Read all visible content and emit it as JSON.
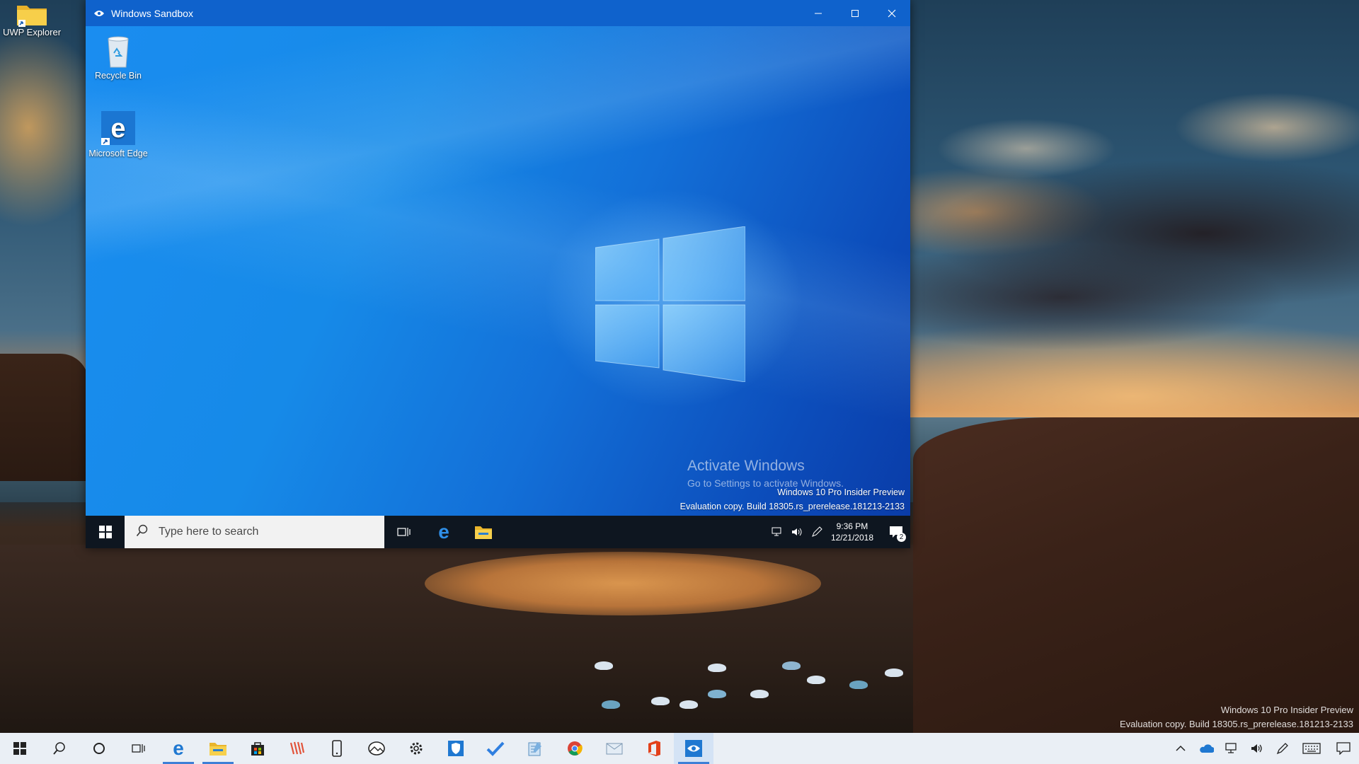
{
  "host": {
    "desktop_icon": {
      "label": "UWP Explorer"
    },
    "watermark": {
      "line1": "Windows 10 Pro Insider Preview",
      "line2": "Evaluation copy. Build 18305.rs_prerelease.181213-2133"
    },
    "taskbar": {
      "items": [
        {
          "icon": "windows-start-icon"
        },
        {
          "icon": "search-icon"
        },
        {
          "icon": "cortana-circle-icon"
        },
        {
          "icon": "task-view-icon"
        },
        {
          "icon": "edge-icon"
        },
        {
          "icon": "file-explorer-icon"
        },
        {
          "icon": "store-icon"
        },
        {
          "icon": "sketch-app-icon"
        },
        {
          "icon": "phone-icon"
        },
        {
          "icon": "photos-app-icon"
        },
        {
          "icon": "settings-gear-icon"
        },
        {
          "icon": "security-shield-icon"
        },
        {
          "icon": "todo-check-icon"
        },
        {
          "icon": "notepad-icon"
        },
        {
          "icon": "chrome-icon"
        },
        {
          "icon": "mail-icon"
        },
        {
          "icon": "office-icon"
        },
        {
          "icon": "windows-sandbox-icon",
          "active": true
        }
      ],
      "tray": [
        "chevron-up-icon",
        "onedrive-cloud-icon",
        "network-icon",
        "volume-icon",
        "pen-icon",
        "keyboard-icon",
        "action-center-icon"
      ]
    }
  },
  "sandbox": {
    "title": "Windows Sandbox",
    "icons": [
      {
        "label": "Recycle Bin"
      },
      {
        "label": "Microsoft Edge"
      }
    ],
    "activate": {
      "title": "Activate Windows",
      "subtitle": "Go to Settings to activate Windows."
    },
    "watermark": {
      "line1": "Windows 10 Pro Insider Preview",
      "line2": "Evaluation copy. Build 18305.rs_prerelease.181213-2133"
    },
    "taskbar": {
      "search_placeholder": "Type here to search",
      "time": "9:36 PM",
      "date": "12/21/2018",
      "notification_count": "2"
    }
  },
  "colors": {
    "titlebar": "#0f62cc",
    "sandbox_taskbar": "#0e1620",
    "host_taskbar": "#eaeff5",
    "accent": "#3d7fd6"
  }
}
